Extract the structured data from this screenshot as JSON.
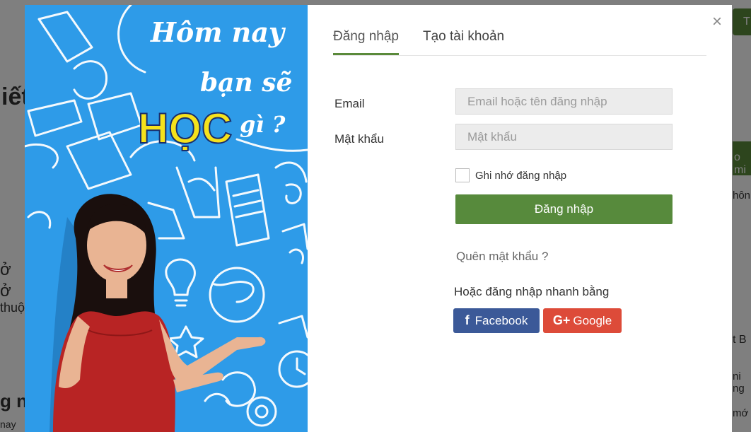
{
  "background": {
    "fragments": [
      "iết",
      "ở",
      "ở",
      "thuộ",
      "g n",
      "nay",
      "T",
      "o mi",
      "hôn",
      "t B",
      "ni ng",
      "mớ"
    ]
  },
  "banner": {
    "headline_line1": "Hôm nay",
    "headline_line2": "bạn sẽ",
    "headline_highlight": "HỌC",
    "headline_end": "gì ?"
  },
  "close_label": "×",
  "tabs": [
    {
      "label": "Đăng nhập",
      "active": true
    },
    {
      "label": "Tạo tài khoản",
      "active": false
    }
  ],
  "form": {
    "email_label": "Email",
    "email_placeholder": "Email hoặc tên đăng nhập",
    "password_label": "Mật khẩu",
    "password_placeholder": "Mật khẩu",
    "remember_label": "Ghi nhớ đăng nhập",
    "login_label": "Đăng nhập",
    "forgot_label": "Quên mật khẩu ?",
    "quick_label": "Hoặc đăng nhập nhanh bằng"
  },
  "social": {
    "facebook_label": "Facebook",
    "facebook_icon": "f",
    "google_label": "Google",
    "google_icon": "G+"
  },
  "colors": {
    "accent": "#578a3c",
    "banner": "#2e9be8",
    "facebook": "#3b5998",
    "google": "#dd4b39",
    "highlight": "#f5e21c"
  }
}
